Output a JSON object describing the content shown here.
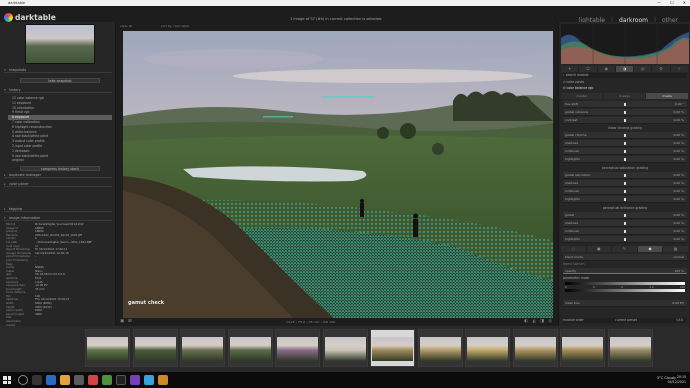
{
  "window": {
    "title": "darktable",
    "controls": [
      "—",
      "☐",
      "✕"
    ]
  },
  "header": {
    "logo": "darktable",
    "tagline": "",
    "status": "1 image of 37 (#4) in current collection is selected",
    "views": [
      "lightable",
      "darkroom",
      "other"
    ],
    "active_view": "darkroom"
  },
  "left_panel": {
    "snapshots_label": "snapshots",
    "take_snapshot": "take snapshot",
    "history_label": "history",
    "history_items": [
      "12 color balance rgb",
      "11 exposure",
      "10 orientation",
      "9 filmic rgb",
      "8 exposure",
      "7 color calibration",
      "6 highlight reconstruction",
      "5 white balance",
      "4 raw black/white point",
      "3 output color profile",
      "2 input color profile",
      "1 demosaic",
      "0 raw black/white point",
      "original"
    ],
    "history_selected": 4,
    "compress_button": "compress history stack",
    "duplicate_label": "duplicate manager",
    "color_picker_label": "color picker",
    "tagging_label": "tagging",
    "image_info_label": "image information",
    "image_info": [
      [
        "filmroll",
        "Pictures\\Digital_Sources\\2021\\12\\02"
      ],
      [
        "image id",
        "18694"
      ],
      [
        "group id",
        "18694"
      ],
      [
        "filename",
        "20211202_Olc001_Dsc01_1624.JPF"
      ],
      [
        "version",
        "0"
      ],
      [
        "full path",
        "...\\Pictures\\Digital_Sourc\\...\\DSC_1624.NEF"
      ],
      [
        "local copy",
        "no"
      ],
      [
        "import timestamp",
        "Fri 03/12/2021 17:40:11"
      ],
      [
        "change timestamp",
        "Sat 04/12/2021 10:40:18"
      ],
      [
        "export timestamp",
        "-"
      ],
      [
        "print timestamp",
        "-"
      ],
      [
        "flags",
        "-"
      ],
      [
        "model",
        "NIKON"
      ],
      [
        "maker",
        "Nikon"
      ],
      [
        "lens",
        "VR 18-55mm f/3.5-5.6"
      ],
      [
        "aperture",
        "f/5.6"
      ],
      [
        "exposure",
        "1/125"
      ],
      [
        "exposure bias",
        "+0.00 EV"
      ],
      [
        "focal length",
        "35 mm"
      ],
      [
        "focus distance",
        "-"
      ],
      [
        "ISO",
        "100"
      ],
      [
        "datetime",
        "Thu 02/12/2021 15:09:23"
      ],
      [
        "width",
        "6000 (6080)"
      ],
      [
        "height",
        "4000 (4032)"
      ],
      [
        "export width",
        "6000"
      ],
      [
        "export height",
        "4000"
      ],
      [
        "title",
        ""
      ],
      [
        "description",
        ""
      ],
      [
        "creator",
        ""
      ],
      [
        "publisher",
        ""
      ],
      [
        "rights",
        ""
      ],
      [
        "notes",
        ""
      ],
      [
        "version name",
        ""
      ]
    ]
  },
  "center": {
    "top_left": "view: all",
    "top_sort": "sort by: color label",
    "image_info_bar": "1/125 • f/5.6 • 35 mm • ISO 100",
    "gamut_label": "gamut check"
  },
  "right_panel": {
    "search_placeholder": "search module",
    "module_group_title": "color zones",
    "module_title": "color balance rgb",
    "tabs": [
      "master",
      "4 ways",
      "masks"
    ],
    "hue_shift": {
      "label": "hue shift",
      "value": "0.00 °"
    },
    "global_vibrance": {
      "label": "global vibrance",
      "value": "0.00 %"
    },
    "contrast": {
      "label": "contrast",
      "value": "0.00 %"
    },
    "section_linear": "linear chroma grading",
    "linear_sliders": [
      {
        "label": "global chroma",
        "value": "0.00 %"
      },
      {
        "label": "shadows",
        "value": "0.00 %"
      },
      {
        "label": "midtones",
        "value": "0.00 %"
      },
      {
        "label": "highlights",
        "value": "0.00 %"
      }
    ],
    "section_sat": "perceptual saturation grading",
    "sat_sliders": [
      {
        "label": "global saturation",
        "value": "0.00 %"
      },
      {
        "label": "shadows",
        "value": "0.00 %"
      },
      {
        "label": "midtones",
        "value": "0.00 %"
      },
      {
        "label": "highlights",
        "value": "0.00 %"
      }
    ],
    "section_bri": "perceptual brilliance grading",
    "bri_sliders": [
      {
        "label": "global",
        "value": "0.00 %"
      },
      {
        "label": "shadows",
        "value": "0.00 %"
      },
      {
        "label": "midtones",
        "value": "0.00 %"
      },
      {
        "label": "highlights",
        "value": "0.00 %"
      }
    ],
    "blend_mode": {
      "label": "blend mode",
      "value": "normal"
    },
    "blend_fulcrum": "blend fulcrum",
    "opacity": {
      "label": "opacity",
      "value": "100 %"
    },
    "param_mask": "parametric mask",
    "channel_scale": [
      "0",
      "0",
      "0",
      "1 0",
      "100"
    ],
    "feather_label": "mask blur",
    "feather_value": "0.00 EV",
    "bottom_module": "module order",
    "bottom_preset": "current preset",
    "bottom_count": "v3.0"
  },
  "filmstrip": {
    "count": 12,
    "current_index": 6
  },
  "taskbar": {
    "weather": "5°C  Cloudy",
    "time": "20:15",
    "date": "04/12/2021"
  },
  "colors": {
    "accent": "#dddddd",
    "panel": "#262626",
    "gamut_overlay": "#4fd6c8"
  }
}
